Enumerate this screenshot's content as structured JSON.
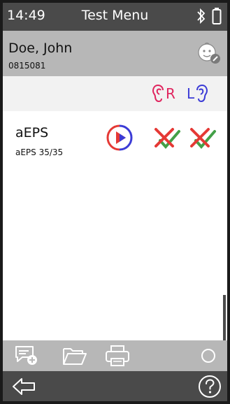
{
  "status": {
    "time": "14:49",
    "title": "Test Menu"
  },
  "patient": {
    "name": "Doe, John",
    "id": "0815081"
  },
  "ears": {
    "right_label": "R",
    "left_label": "L"
  },
  "tests": [
    {
      "name": "aEPS",
      "detail": "aEPS 35/35"
    }
  ],
  "colors": {
    "right_ear": "#e0245e",
    "left_ear": "#3b3bd6",
    "fail": "#e53935",
    "pass": "#43a047"
  }
}
